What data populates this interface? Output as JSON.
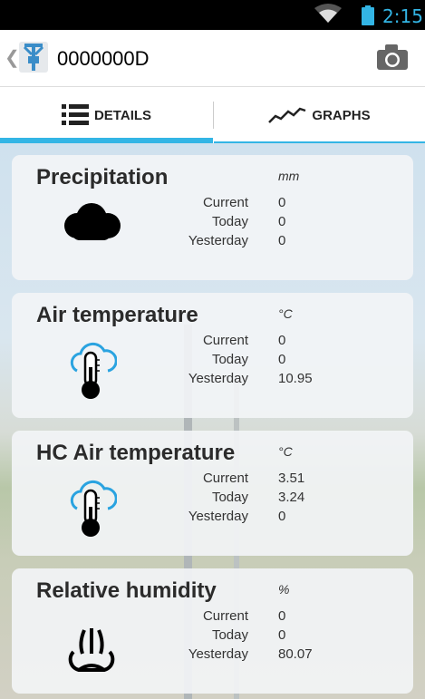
{
  "status_bar": {
    "time": "2:15",
    "wifi_icon": "wifi-icon",
    "battery_icon": "battery-icon"
  },
  "action_bar": {
    "back_icon": "chevron-left-icon",
    "app_icon": "station-app-icon",
    "title": "0000000D",
    "camera_icon": "camera-icon"
  },
  "tabs": [
    {
      "label": "DETAILS",
      "icon": "list-icon",
      "selected": true
    },
    {
      "label": "GRAPHS",
      "icon": "line-graph-icon",
      "selected": false
    }
  ],
  "row_labels": {
    "current": "Current",
    "today": "Today",
    "yesterday": "Yesterday"
  },
  "sensors": [
    {
      "name": "Precipitation",
      "unit": "mm",
      "icon": "cloud-icon",
      "current": "0",
      "today": "0",
      "yesterday": "0"
    },
    {
      "name": "Air temperature",
      "unit": "°C",
      "icon": "thermometer-cloud-icon",
      "current": "0",
      "today": "0",
      "yesterday": "10.95"
    },
    {
      "name": "HC Air temperature",
      "unit": "°C",
      "icon": "thermometer-cloud-icon",
      "current": "3.51",
      "today": "3.24",
      "yesterday": "0"
    },
    {
      "name": "Relative humidity",
      "unit": "%",
      "icon": "humidity-icon",
      "current": "0",
      "today": "0",
      "yesterday": "80.07"
    }
  ],
  "colors": {
    "accent": "#33b5e5",
    "thermometer_blue": "#2aa3e0"
  }
}
